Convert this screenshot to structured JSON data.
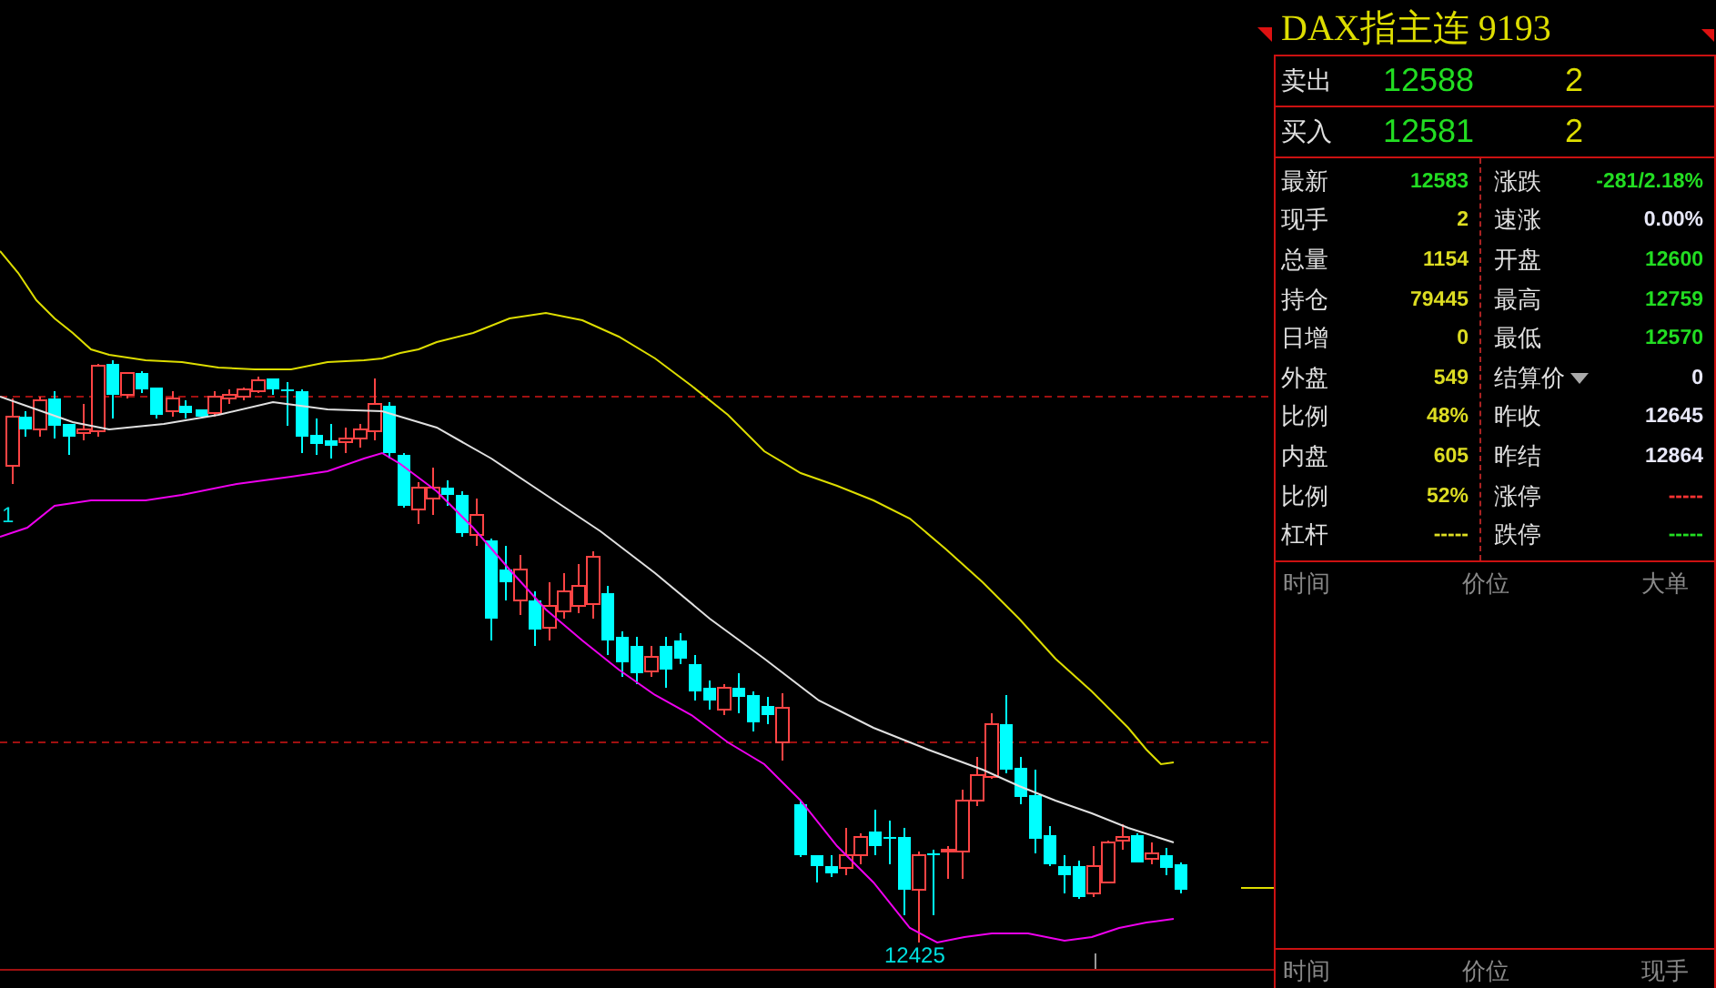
{
  "title": "DAX指主连 9193",
  "quotes": [
    {
      "label": "卖出",
      "price": "12588",
      "volume": "2"
    },
    {
      "label": "买入",
      "price": "12581",
      "volume": "2"
    }
  ],
  "stats": [
    {
      "left": {
        "label": "最新",
        "value": "12583",
        "color": "#22dd22"
      },
      "right": {
        "label": "涨跌",
        "value": "-281/2.18%",
        "color": "#22dd22"
      }
    },
    {
      "left": {
        "label": "现手",
        "value": "2",
        "color": "#dddd22"
      },
      "right": {
        "label": "速涨",
        "value": "0.00%",
        "color": "#e8e8f8"
      }
    },
    {
      "left": {
        "label": "总量",
        "value": "1154",
        "color": "#dddd22"
      },
      "right": {
        "label": "开盘",
        "value": "12600",
        "color": "#22dd22"
      }
    },
    {
      "left": {
        "label": "持仓",
        "value": "79445",
        "color": "#dddd22"
      },
      "right": {
        "label": "最高",
        "value": "12759",
        "color": "#22dd22"
      }
    },
    {
      "left": {
        "label": "日增",
        "value": "0",
        "color": "#dddd22"
      },
      "right": {
        "label": "最低",
        "value": "12570",
        "color": "#22dd22"
      }
    },
    {
      "left": {
        "label": "外盘",
        "value": "549",
        "color": "#dddd22"
      },
      "right": {
        "label": "结算价",
        "value": "0",
        "color": "#e8e8f8",
        "dropdown": true
      }
    },
    {
      "left": {
        "label": "比例",
        "value": "48%",
        "color": "#dddd22"
      },
      "right": {
        "label": "昨收",
        "value": "12645",
        "color": "#e8e8f8"
      }
    },
    {
      "left": {
        "label": "内盘",
        "value": "605",
        "color": "#dddd22"
      },
      "right": {
        "label": "昨结",
        "value": "12864",
        "color": "#e8e8f8"
      }
    },
    {
      "left": {
        "label": "比例",
        "value": "52%",
        "color": "#dddd22"
      },
      "right": {
        "label": "涨停",
        "value": "-----",
        "color": "#ff3333"
      }
    },
    {
      "left": {
        "label": "杠杆",
        "value": "-----",
        "color": "#dddd22"
      },
      "right": {
        "label": "跌停",
        "value": "-----",
        "color": "#22dd22"
      }
    }
  ],
  "ticks_header": [
    "时间",
    "价位",
    "大单"
  ],
  "trades_header": [
    "时间",
    "价位",
    "现手"
  ],
  "chart": {
    "left_label": "1",
    "low_label": "12425"
  }
}
